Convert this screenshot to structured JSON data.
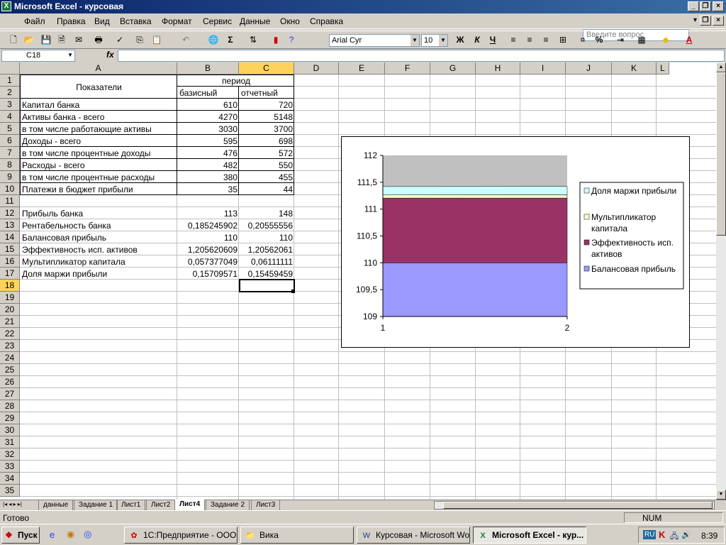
{
  "window": {
    "title": "Microsoft Excel - курсовая"
  },
  "menu": [
    "Файл",
    "Правка",
    "Вид",
    "Вставка",
    "Формат",
    "Сервис",
    "Данные",
    "Окно",
    "Справка"
  ],
  "ask_placeholder": "Введите вопрос",
  "toolbar": {
    "font": "Arial Cyr",
    "size": "10",
    "bold": "Ж",
    "italic": "К",
    "underline": "Ч",
    "percent": "%",
    "sigma": "Σ"
  },
  "namebox": "C18",
  "fx": "fx",
  "columns": [
    "A",
    "B",
    "C",
    "D",
    "E",
    "F",
    "G",
    "H",
    "I",
    "J",
    "K",
    "L"
  ],
  "rows": [
    "1",
    "2",
    "3",
    "4",
    "5",
    "6",
    "7",
    "8",
    "9",
    "10",
    "11",
    "12",
    "13",
    "14",
    "15",
    "16",
    "17",
    "18",
    "19",
    "20",
    "21",
    "22",
    "23",
    "24",
    "25",
    "26",
    "27",
    "28",
    "29",
    "30",
    "31",
    "32",
    "33",
    "34",
    "35"
  ],
  "sheet": {
    "header_a": "Показатели",
    "header_period": "период",
    "header_b": "базисный",
    "header_c": "отчетный",
    "table1": [
      {
        "label": "Капитал банка",
        "b": "610",
        "c": "720"
      },
      {
        "label": "Активы банка - всего",
        "b": "4270",
        "c": "5148"
      },
      {
        "label": "в том числе работающие активы",
        "b": "3030",
        "c": "3700"
      },
      {
        "label": "Доходы - всего",
        "b": "595",
        "c": "698"
      },
      {
        "label": "в том числе процентные доходы",
        "b": "476",
        "c": "572"
      },
      {
        "label": "Расходы - всего",
        "b": "482",
        "c": "550"
      },
      {
        "label": "в том числе процентные расходы",
        "b": "380",
        "c": "455"
      },
      {
        "label": "Платежи в бюджет прибыли",
        "b": "35",
        "c": "44"
      }
    ],
    "table2": [
      {
        "label": "Прибыль банка",
        "b": "113",
        "c": "148"
      },
      {
        "label": "Рентабельность банка",
        "b": "0,185245902",
        "c": "0,20555556"
      },
      {
        "label": "Балансовая прибыль",
        "b": "110",
        "c": "110"
      },
      {
        "label": "Эффективность исп. активов",
        "b": "1,205620609",
        "c": "1,20562061"
      },
      {
        "label": "Мультипликатор капитала",
        "b": "0,057377049",
        "c": "0,06111111"
      },
      {
        "label": "Доля маржи прибыли",
        "b": "0,15709571",
        "c": "0,15459459"
      }
    ]
  },
  "chart_data": {
    "type": "area",
    "stacked": true,
    "x": [
      "1",
      "2"
    ],
    "ylim": [
      109,
      112
    ],
    "yticks": [
      "109",
      "109,5",
      "110",
      "110,5",
      "111",
      "111,5",
      "112"
    ],
    "legend_position": "right",
    "series": [
      {
        "name": "Балансовая прибыль",
        "values": [
          110,
          110
        ],
        "color": "#9999ff"
      },
      {
        "name": "Эффективность исп. активов",
        "values": [
          1.205620609,
          1.20562061
        ],
        "color": "#993366"
      },
      {
        "name": "Мультипликатор капитала",
        "values": [
          0.057377049,
          0.06111111
        ],
        "color": "#ffffcc"
      },
      {
        "name": "Доля маржи прибыли",
        "values": [
          0.15709571,
          0.15459459
        ],
        "color": "#ccffff"
      }
    ],
    "plot_area_color": "#c0c0c0",
    "legend": [
      "Доля маржи прибыли",
      "Мультипликатор капитала",
      "Эффективность исп. активов",
      "Балансовая прибыль"
    ],
    "legend_lines": [
      [
        "Доля маржи прибыли"
      ],
      [
        "Мультипликатор",
        "капитала"
      ],
      [
        "Эффективность исп.",
        "активов"
      ],
      [
        "Балансовая прибыль"
      ]
    ]
  },
  "sheets": [
    "данные",
    "Задание 1",
    "Лист1",
    "Лист2",
    "Лист4",
    "Задание 2",
    "Лист3"
  ],
  "active_sheet": "Лист4",
  "status": {
    "ready": "Готово",
    "num": "NUM"
  },
  "taskbar": {
    "start": "Пуск",
    "tasks": [
      "1С:Предприятие - ООО ...",
      "Вика",
      "Курсовая - Microsoft Word",
      "Microsoft Excel - кур..."
    ],
    "lang": "RU",
    "clock": "8:39"
  }
}
